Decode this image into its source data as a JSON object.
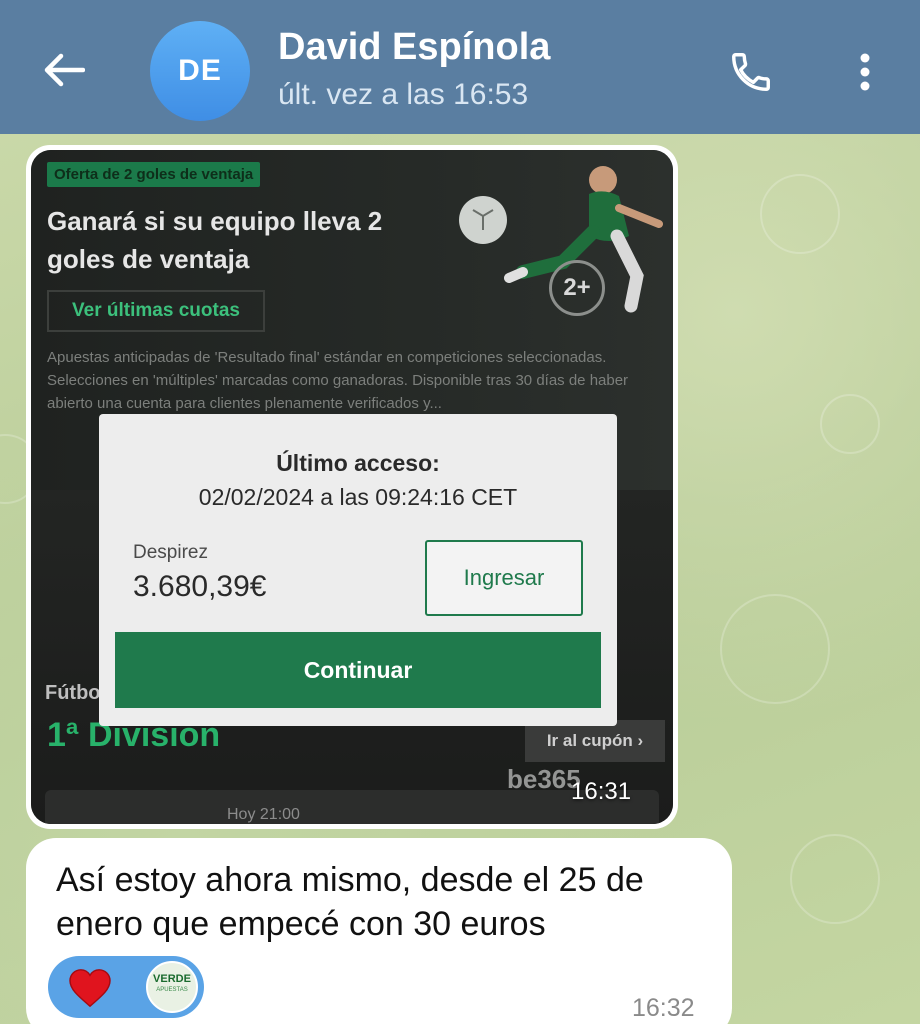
{
  "header": {
    "contact_name": "David Espínola",
    "last_seen": "últ. vez a las 16:53",
    "avatar_initials": "DE",
    "back_icon": "arrow-left-icon",
    "call_icon": "phone-icon",
    "menu_icon": "more-vertical-icon"
  },
  "image_message": {
    "timestamp": "16:31",
    "screenshot": {
      "promo_tag": "Oferta de 2 goles de ventaja",
      "promo_title": "Ganará si su equipo lleva 2 goles de ventaja",
      "odds_button": "Ver últimas cuotas",
      "promo_terms": "Apuestas anticipadas de 'Resultado final' estándar en competiciones seleccionadas. Selecciones en 'múltiples' marcadas como ganadoras. Disponible tras 30 días de haber abierto una cuenta para clientes plenamente verificados y...",
      "badge": "2+",
      "sport_label": "Fútbo",
      "league_title": "1ª División",
      "coupon_button": "Ir al cupón ›",
      "brand_watermark": "be365",
      "match_time": "Hoy 21:00",
      "popup": {
        "title": "Último acceso:",
        "date": "02/02/2024  a las  09:24:16 CET",
        "username": "Despirez",
        "balance": "3.680,39€",
        "login_button": "Ingresar",
        "continue_button": "Continuar"
      }
    }
  },
  "text_message": {
    "text": "Así estoy ahora mismo, desde el 25 de enero que empecé con 30 euros",
    "timestamp": "16:32",
    "reaction_emoji": "heart-icon",
    "reactor_label": "VERDE",
    "reactor_sub": "APUESTAS"
  },
  "colors": {
    "header_bg": "#5a7ea1",
    "avatar_bg": "#4a9cec",
    "brand_green": "#1f7a4c",
    "reaction_bubble": "#5aa3e6"
  }
}
